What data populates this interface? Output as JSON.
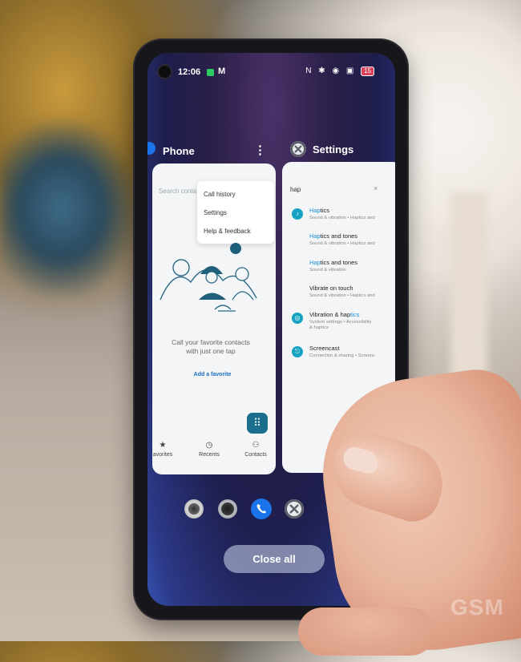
{
  "status_bar": {
    "time": "12:06",
    "notification": "M",
    "icons": "N ✱ ◉ ▣",
    "battery": "15"
  },
  "recents": [
    {
      "app_name": "Phone",
      "more_icon": "⋮",
      "search_placeholder": "Search conta",
      "menu": [
        "Call history",
        "Settings",
        "Help & feedback"
      ],
      "empty_message": "Call your favorite contacts with just one tap",
      "add_favorite": "Add a favorite",
      "bottom_tabs": [
        {
          "icon": "star-icon",
          "label": "avorites"
        },
        {
          "icon": "clock-icon",
          "label": "Recents"
        },
        {
          "icon": "contacts-icon",
          "label": "Contacts"
        }
      ]
    },
    {
      "app_name": "Settings",
      "search_query": "hap",
      "clear": "×",
      "results": [
        {
          "match": "Hap",
          "rest": "tics",
          "sub": "Sound & vibration • Haptics and",
          "icon": "bell-icon"
        },
        {
          "match": "Hap",
          "rest": "tics and tones",
          "sub": "Sound & vibration • Haptics and",
          "icon": ""
        },
        {
          "match": "Hap",
          "rest": "tics and tones",
          "sub": "Sound & vibration",
          "icon": ""
        },
        {
          "match": "",
          "rest": "Vibrate on touch",
          "sub": "Sound & vibration • Haptics and",
          "icon": ""
        },
        {
          "match": "",
          "rest": "Vibration & hap",
          "rest2": "tics",
          "sub": "System settings • Accessibility",
          "sub2": "& haptics",
          "icon": "accessibility-icon"
        },
        {
          "match": "",
          "rest": "Screencast",
          "sub": "Connection & sharing • Screenc",
          "icon": "screencast-icon"
        }
      ]
    }
  ],
  "dock_icons": [
    "camera-app-icon",
    "camera-shutter-icon",
    "phone-app-icon",
    "settings-app-icon"
  ],
  "close_all_label": "Close all",
  "watermark": "GSM",
  "colors": {
    "accent": "#1b8fd6",
    "settings_icon": "#16a3c2",
    "fab": "#1b6e8c",
    "phone_blue": "#1a73e8"
  }
}
